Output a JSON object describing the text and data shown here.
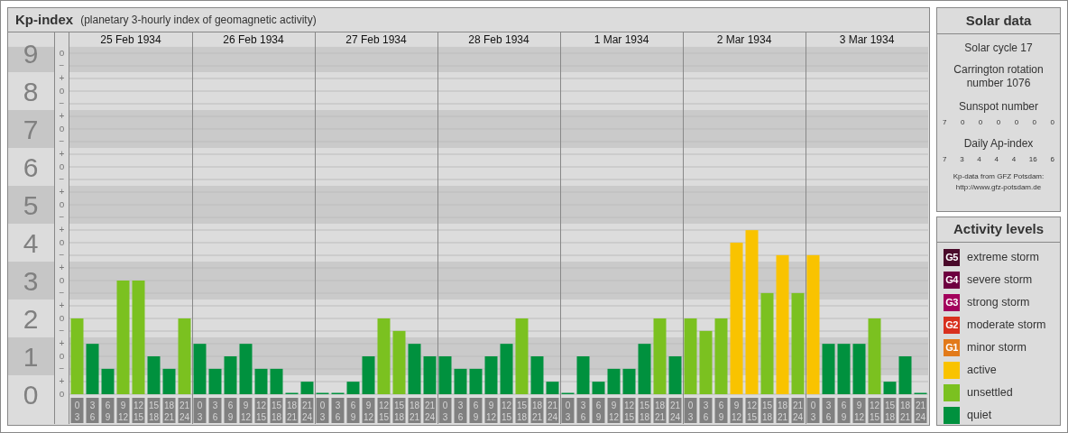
{
  "header": {
    "title": "Kp-index",
    "subtitle": "(planetary 3-hourly index of geomagnetic activity)"
  },
  "kp_chart": {
    "days": [
      "25 Feb 1934",
      "26 Feb 1934",
      "27 Feb 1934",
      "28 Feb 1934",
      "1 Mar 1934",
      "2 Mar 1934",
      "3 Mar 1934"
    ],
    "sub_tick_labels": [
      "o",
      "−",
      "+",
      "o",
      "−",
      "+",
      "o",
      "−",
      "+",
      "o",
      "−",
      "+",
      "o",
      "−",
      "+",
      "o",
      "−",
      "+",
      "o",
      "−",
      "+",
      "o",
      "−",
      "+",
      "o",
      "−",
      "+",
      "o"
    ],
    "chart_data": {
      "type": "bar",
      "stacked": true,
      "grid": true,
      "ylim": [
        0,
        9.17
      ],
      "yticks": [
        {
          "value": 9,
          "label": "9"
        },
        {
          "value": 8,
          "label": "8"
        },
        {
          "value": 7,
          "label": "7"
        },
        {
          "value": 6,
          "label": "6"
        },
        {
          "value": 5,
          "label": "5"
        },
        {
          "value": 4,
          "label": "4"
        },
        {
          "value": 3,
          "label": "3"
        },
        {
          "value": 2,
          "label": "2"
        },
        {
          "value": 1,
          "label": "1"
        },
        {
          "value": 0,
          "label": "0"
        }
      ],
      "categories": [
        "0 3",
        "3 6",
        "6 9",
        "9 12",
        "12 15",
        "15 18",
        "18 21",
        "21 24",
        "0 3",
        "3 6",
        "6 9",
        "9 12",
        "12 15",
        "15 18",
        "18 21",
        "21 24",
        "0 3",
        "3 6",
        "6 9",
        "9 12",
        "12 15",
        "15 18",
        "18 21",
        "21 24",
        "0 3",
        "3 6",
        "6 9",
        "9 12",
        "12 15",
        "15 18",
        "18 21",
        "21 24",
        "0 3",
        "3 6",
        "6 9",
        "9 12",
        "12 15",
        "15 18",
        "18 21",
        "21 24",
        "0 3",
        "3 6",
        "6 9",
        "9 12",
        "12 15",
        "15 18",
        "18 21",
        "21 24",
        "0 3",
        "3 6",
        "6 9",
        "9 12",
        "12 15",
        "15 18",
        "18 21",
        "21 24"
      ],
      "series": [
        {
          "color": "#00913e",
          "values": [
            null,
            1.33,
            0.67,
            null,
            null,
            1,
            0.67,
            null,
            1.33,
            0.67,
            1,
            1.33,
            0.67,
            0.67,
            0,
            0.33,
            0,
            0,
            0.33,
            1,
            null,
            null,
            1.33,
            1,
            1,
            0.67,
            0.67,
            1,
            1.33,
            null,
            1,
            0.33,
            0,
            1,
            0.33,
            0.67,
            0.67,
            1.33,
            null,
            1,
            null,
            null,
            null,
            null,
            null,
            null,
            null,
            null,
            null,
            1.33,
            1.33,
            1.33,
            null,
            0.33,
            1,
            0
          ]
        },
        {
          "color": "#7bc120",
          "values": [
            2,
            null,
            null,
            3,
            3,
            null,
            null,
            2,
            null,
            null,
            null,
            null,
            null,
            null,
            null,
            null,
            null,
            null,
            null,
            null,
            2,
            1.67,
            null,
            null,
            null,
            null,
            null,
            null,
            null,
            2,
            null,
            null,
            null,
            null,
            null,
            null,
            null,
            null,
            2,
            null,
            2,
            1.67,
            2,
            null,
            null,
            2.67,
            null,
            2.67,
            null,
            null,
            null,
            null,
            2,
            null,
            null,
            null
          ]
        },
        {
          "color": "#f9c300",
          "values": [
            null,
            null,
            null,
            null,
            null,
            null,
            null,
            null,
            null,
            null,
            null,
            null,
            null,
            null,
            null,
            null,
            null,
            null,
            null,
            null,
            null,
            null,
            null,
            null,
            null,
            null,
            null,
            null,
            null,
            null,
            null,
            null,
            null,
            null,
            null,
            null,
            null,
            null,
            null,
            null,
            null,
            null,
            null,
            4,
            4.33,
            null,
            3.67,
            null,
            3.67,
            null,
            null,
            null,
            null,
            null,
            null,
            null
          ]
        }
      ]
    }
  },
  "solar_data": {
    "title": "Solar data",
    "solar_cycle": "Solar cycle 17",
    "carrington": "Carrington rotation number 1076",
    "sunspot_title": "Sunspot number",
    "sunspot_values": [
      "7",
      "0",
      "0",
      "0",
      "0",
      "0",
      "0"
    ],
    "ap_title": "Daily Ap-index",
    "ap_values": [
      "7",
      "3",
      "4",
      "4",
      "4",
      "16",
      "6"
    ],
    "source": "Kp-data from GFZ Potsdam:",
    "source_link": "http://www.gfz-potsdam.de"
  },
  "activity_levels": {
    "title": "Activity levels",
    "items": [
      {
        "badge": "G5",
        "label": "extreme storm",
        "color": "#4a0a2a"
      },
      {
        "badge": "G4",
        "label": "severe storm",
        "color": "#6e0040"
      },
      {
        "badge": "G3",
        "label": "strong storm",
        "color": "#a3005c"
      },
      {
        "badge": "G2",
        "label": "moderate storm",
        "color": "#d8301e"
      },
      {
        "badge": "G1",
        "label": "minor storm",
        "color": "#e27a1a"
      },
      {
        "label": "active",
        "color": "#f9c300"
      },
      {
        "label": "unsettled",
        "color": "#7bc120"
      },
      {
        "label": "quiet",
        "color": "#00913e"
      }
    ]
  }
}
